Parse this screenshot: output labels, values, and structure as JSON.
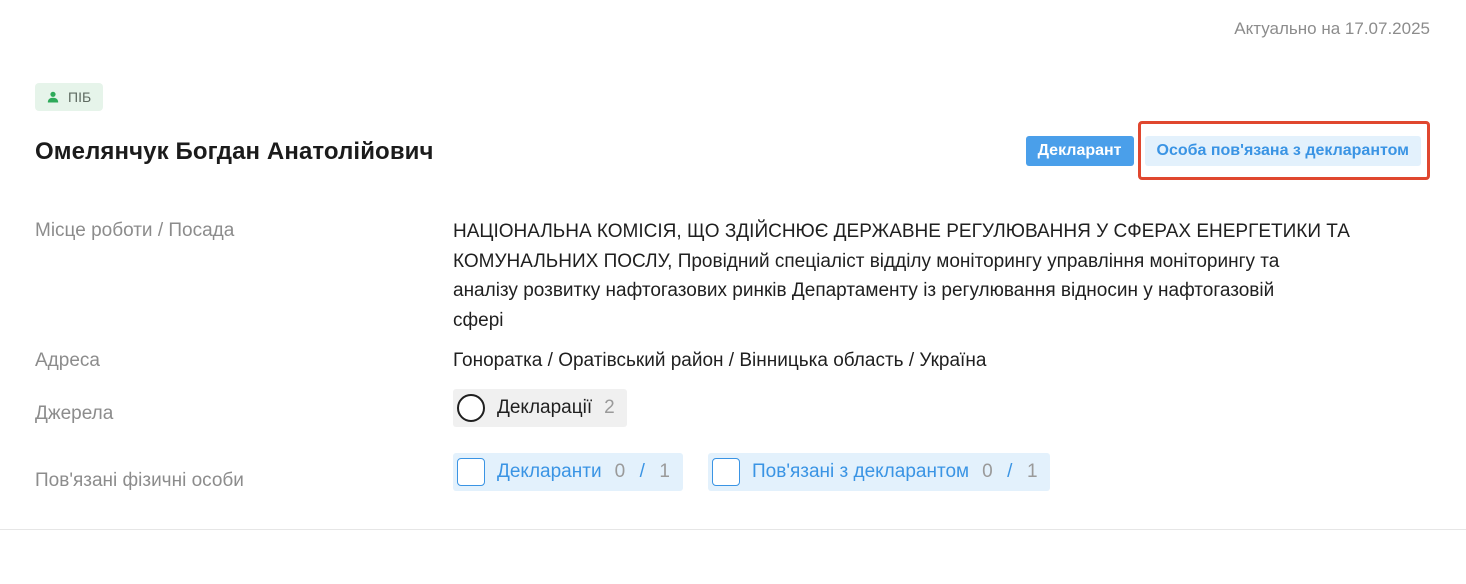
{
  "actual_date": "Актуально на 17.07.2025",
  "pib_tag": {
    "icon": "person-icon",
    "label": "ПІБ"
  },
  "person_name": "Омелянчук Богдан Анатолійович",
  "roles": {
    "declarant": "Декларант",
    "related": "Особа пов'язана з декларантом",
    "highlight_color": "#e0472f"
  },
  "details": {
    "work_label": "Місце роботи / Посада",
    "work_lines": [
      "НАЦІОНАЛЬНА КОМІСІЯ, ЩО ЗДІЙСНЮЄ ДЕРЖАВНЕ РЕГУЛЮВАННЯ У СФЕРАХ ЕНЕРГЕТИКИ ТА",
      "КОМУНАЛЬНИХ ПОСЛУ, Провідний спеціаліст відділу моніторингу управління моніторингу та",
      "аналізу розвитку нафтогазових ринків Департаменту із регулювання відносин у нафтогазовій",
      "сфері"
    ],
    "address_label": "Адреса",
    "address_value": "Гоноратка / Оратівський район / Вінницька область / Україна",
    "sources_label": "Джерела",
    "sources": {
      "label": "Декларації",
      "count": "2"
    },
    "related_label": "Пов'язані фізичні особи",
    "related": [
      {
        "label": "Декларанти",
        "value": "0",
        "sep": "/",
        "total": "1"
      },
      {
        "label": "Пов'язані з декларантом",
        "value": "0",
        "sep": "/",
        "total": "1"
      }
    ]
  },
  "colors": {
    "accent": "#3a94e4",
    "declarant_badge": "#4a9fea",
    "tag_bg": "#e6f4ea",
    "tag_icon": "#2eaa5a"
  }
}
